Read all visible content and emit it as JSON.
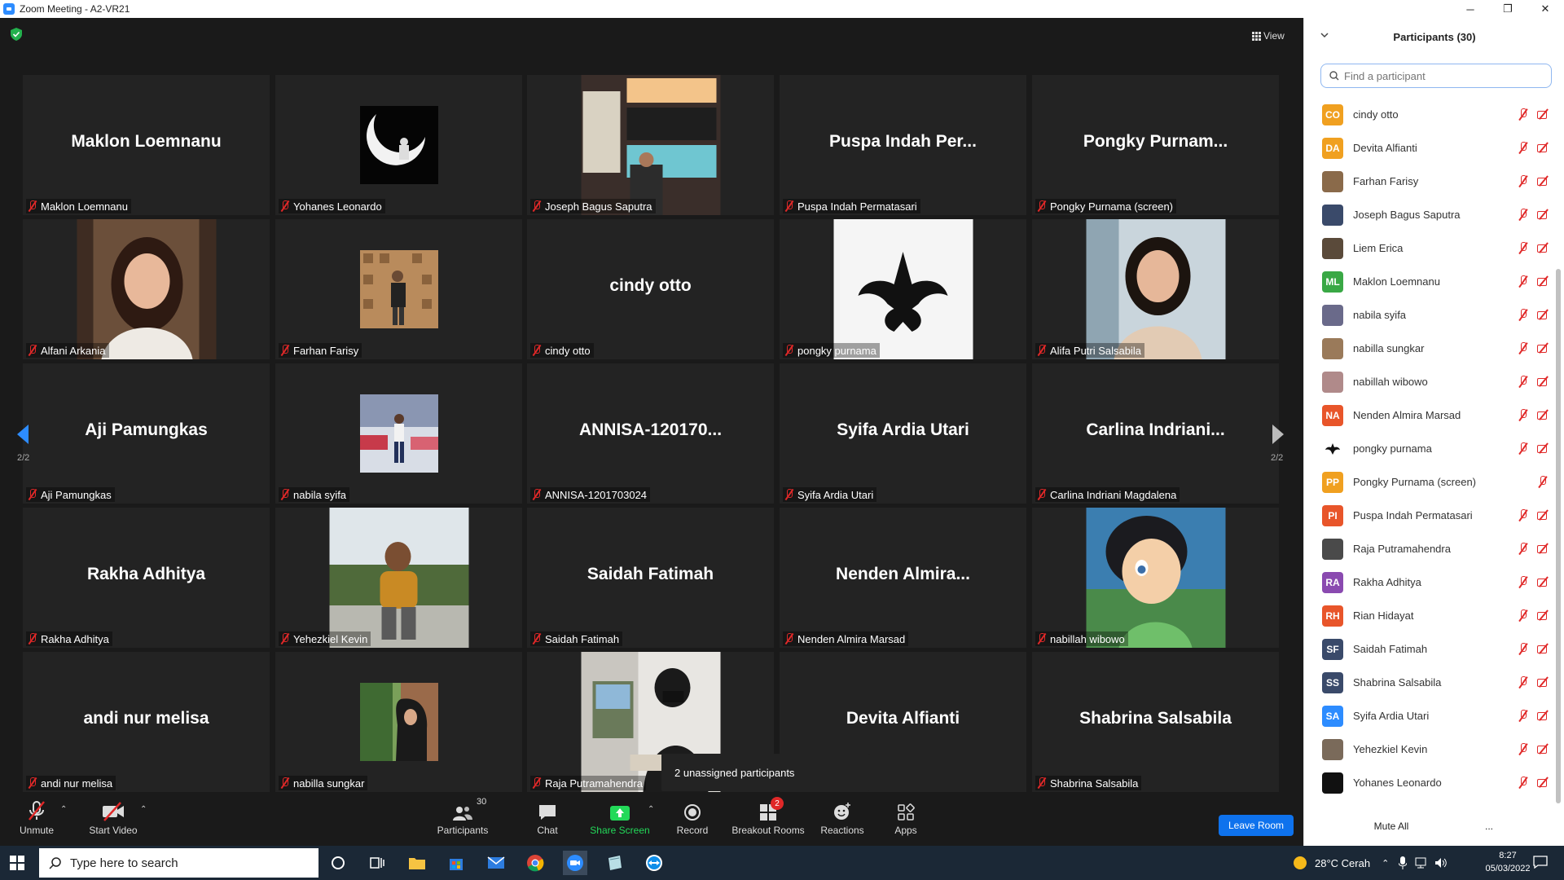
{
  "window": {
    "title": "Zoom Meeting - A2-VR21",
    "minimize": "─",
    "maximize": "❐",
    "close": "✕"
  },
  "view_label": "View",
  "page_indicator": "2/2",
  "tiles": [
    {
      "big": "Maklon Loemnanu",
      "label": "Maklon Loemnanu"
    },
    {
      "big": "",
      "label": "Yohanes Leonardo",
      "pic": "moon"
    },
    {
      "big": "",
      "label": "Joseph Bagus Saputra",
      "pic": "beach"
    },
    {
      "big": "Puspa Indah Per...",
      "label": "Puspa Indah Permatasari"
    },
    {
      "big": "Pongky  Purnam...",
      "label": "Pongky Purnama (screen)"
    },
    {
      "big": "",
      "label": "Alfani Arkania",
      "pic": "woman1"
    },
    {
      "big": "",
      "label": "Farhan Farisy",
      "pic": "man-brick"
    },
    {
      "big": "cindy otto",
      "label": "cindy otto"
    },
    {
      "big": "",
      "label": "pongky purnama",
      "pic": "logo"
    },
    {
      "big": "",
      "label": "Alifa Putri Salsabila",
      "pic": "woman2"
    },
    {
      "big": "Aji Pamungkas",
      "label": "Aji Pamungkas"
    },
    {
      "big": "",
      "label": "nabila syifa",
      "pic": "street"
    },
    {
      "big": "ANNISA-120170...",
      "label": "ANNISA-1201703024"
    },
    {
      "big": "Syifa Ardia Utari",
      "label": "Syifa Ardia Utari"
    },
    {
      "big": "Carlina  Indriani...",
      "label": "Carlina Indriani Magdalena"
    },
    {
      "big": "Rakha Adhitya",
      "label": "Rakha Adhitya"
    },
    {
      "big": "",
      "label": "Yehezkiel Kevin",
      "pic": "man-outdoor"
    },
    {
      "big": "Saidah Fatimah",
      "label": "Saidah Fatimah"
    },
    {
      "big": "Nenden  Almira...",
      "label": "Nenden Almira Marsad"
    },
    {
      "big": "",
      "label": "nabillah wibowo",
      "pic": "fairy"
    },
    {
      "big": "andi nur melisa",
      "label": "andi nur melisa"
    },
    {
      "big": "",
      "label": "nabilla sungkar",
      "pic": "hijab"
    },
    {
      "big": "",
      "label": "Raja Putramahendra",
      "pic": "man-mask"
    },
    {
      "big": "Devita Alfianti",
      "label": ""
    },
    {
      "big": "Shabrina Salsabila",
      "label": "Shabrina Salsabila"
    }
  ],
  "tooltip": "2 unassigned participants",
  "toolbar": {
    "unmute": "Unmute",
    "start_video": "Start Video",
    "participants": "Participants",
    "participants_count": "30",
    "chat": "Chat",
    "share_screen": "Share Screen",
    "record": "Record",
    "breakout_rooms": "Breakout Rooms",
    "breakout_badge": "2",
    "reactions": "Reactions",
    "apps": "Apps",
    "leave_room": "Leave Room"
  },
  "panel": {
    "title": "Participants (30)",
    "search_placeholder": "Find a participant",
    "mute_all": "Mute All",
    "more": "...",
    "participants": [
      {
        "name": "cindy otto",
        "initials": "CO",
        "color": "#f0a020",
        "video": true
      },
      {
        "name": "Devita Alfianti",
        "initials": "DA",
        "color": "#f0a020",
        "video": true
      },
      {
        "name": "Farhan Farisy",
        "initials": "",
        "color": "#8a6a4a",
        "video": true
      },
      {
        "name": "Joseph Bagus Saputra",
        "initials": "",
        "color": "#3a4a6a",
        "video": true
      },
      {
        "name": "Liem Erica",
        "initials": "",
        "color": "#5a4a3a",
        "video": true
      },
      {
        "name": "Maklon Loemnanu",
        "initials": "ML",
        "color": "#39a845",
        "video": true
      },
      {
        "name": "nabila syifa",
        "initials": "",
        "color": "#6a6a8a",
        "video": true
      },
      {
        "name": "nabilla sungkar",
        "initials": "",
        "color": "#9a7a5a",
        "video": true
      },
      {
        "name": "nabillah wibowo",
        "initials": "",
        "color": "#b08a8a",
        "video": true
      },
      {
        "name": "Nenden Almira Marsad",
        "initials": "NA",
        "color": "#e8552a",
        "video": true
      },
      {
        "name": "pongky purnama",
        "initials": "",
        "color": "#ffffff",
        "video": true
      },
      {
        "name": "Pongky Purnama (screen)",
        "initials": "PP",
        "color": "#f0a020",
        "video": false
      },
      {
        "name": "Puspa Indah Permatasari",
        "initials": "PI",
        "color": "#e8552a",
        "video": true
      },
      {
        "name": "Raja Putramahendra",
        "initials": "",
        "color": "#4a4a4a",
        "video": true
      },
      {
        "name": "Rakha Adhitya",
        "initials": "RA",
        "color": "#8a4ab0",
        "video": true
      },
      {
        "name": "Rian Hidayat",
        "initials": "RH",
        "color": "#e8552a",
        "video": true
      },
      {
        "name": "Saidah Fatimah",
        "initials": "SF",
        "color": "#3a4a6a",
        "video": true
      },
      {
        "name": "Shabrina Salsabila",
        "initials": "SS",
        "color": "#3a4a6a",
        "video": true
      },
      {
        "name": "Syifa Ardia Utari",
        "initials": "SA",
        "color": "#2d8cff",
        "video": true
      },
      {
        "name": "Yehezkiel Kevin",
        "initials": "",
        "color": "#7a6a5a",
        "video": true
      },
      {
        "name": "Yohanes Leonardo",
        "initials": "",
        "color": "#111111",
        "video": true
      }
    ]
  },
  "taskbar": {
    "search_placeholder": "Type here to search",
    "weather": "28°C  Cerah",
    "time": "8:27",
    "date": "05/03/2022"
  },
  "colors": {
    "accent_blue": "#0e72ed",
    "muted_red": "#e02828",
    "share_green": "#23d959"
  }
}
